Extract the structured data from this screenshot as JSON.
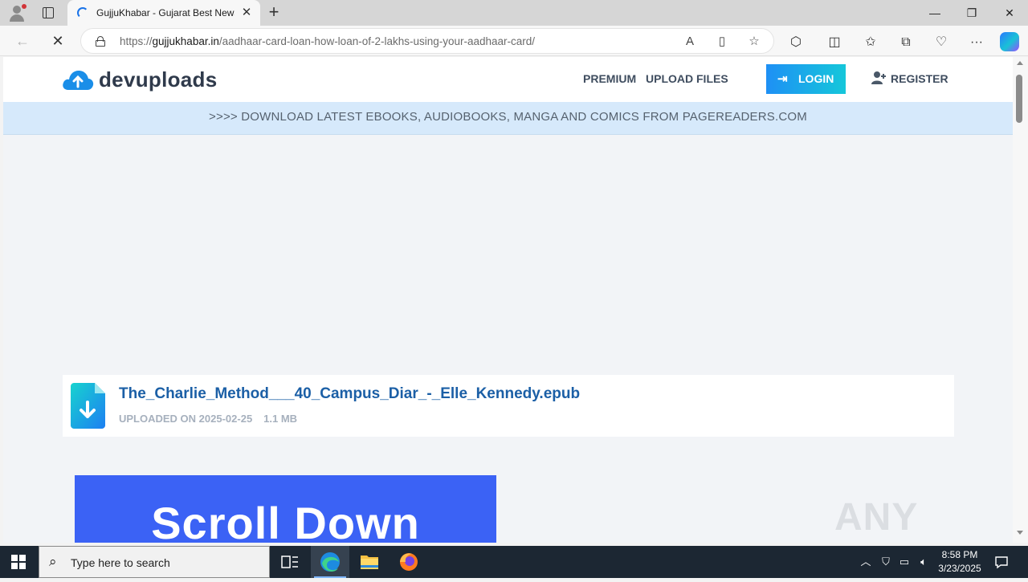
{
  "browser": {
    "tab": {
      "title": "GujjuKhabar - Gujarat Best News Website"
    },
    "new_tab_icon": "plus-icon",
    "window": {
      "minimize": "—",
      "maximize": "❐",
      "close": "✕"
    },
    "address": {
      "scheme": "https://",
      "host": "gujjukhabar.in",
      "path": "/aadhaar-card-loan-how-loan-of-2-lakhs-using-your-aadhaar-card/"
    }
  },
  "site": {
    "logo": "devuploads",
    "nav": {
      "premium": "PREMIUM",
      "upload": "UPLOAD FILES",
      "login": "LOGIN",
      "register": "REGISTER"
    },
    "promo": ">>>> DOWNLOAD LATEST EBOOKS, AUDIOBOOKS, MANGA AND COMICS FROM PAGEREADERS.COM",
    "file": {
      "name": "The_Charlie_Method___40_Campus_Diar_-_Elle_Kennedy.epub",
      "uploaded": "UPLOADED ON 2025-02-25",
      "size": "1.1 MB"
    },
    "banner": "Scroll Down",
    "colors": {
      "accent": "#1e90f5",
      "file_link": "#1b5fa6",
      "banner": "#3b62f5"
    }
  },
  "watermark": "ANY RUN",
  "taskbar": {
    "search_placeholder": "Type here to search",
    "time": "8:58 PM",
    "date": "3/23/2025"
  }
}
